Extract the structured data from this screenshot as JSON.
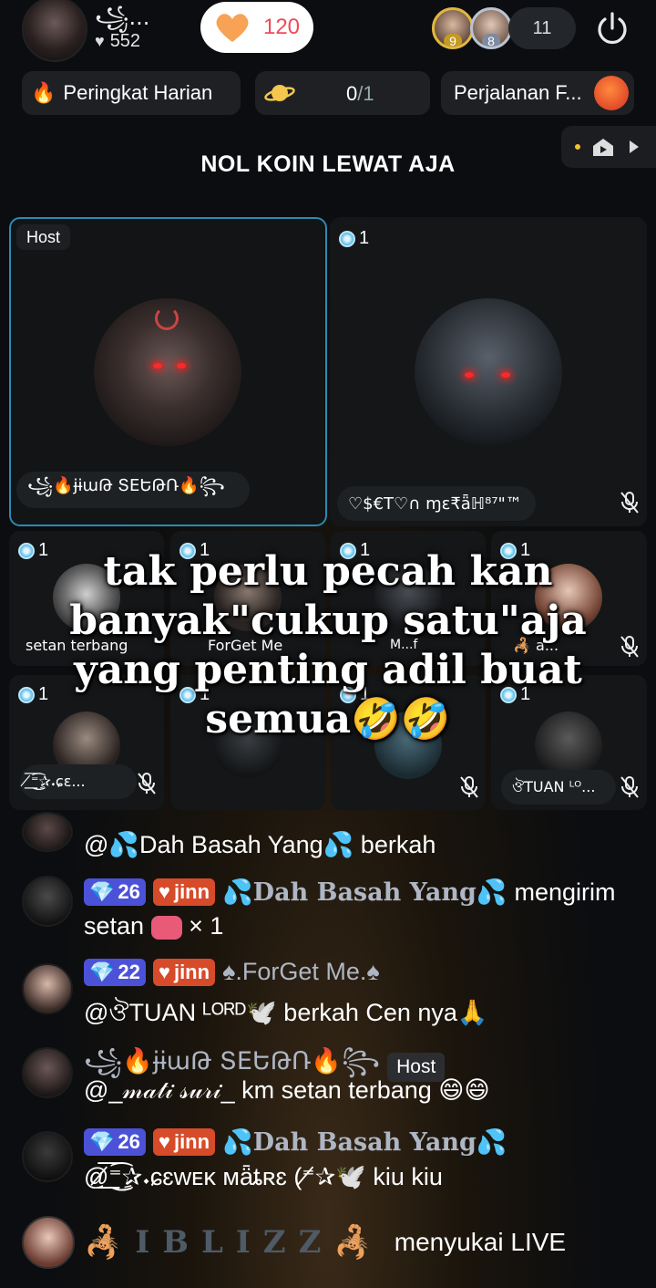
{
  "header": {
    "host_name": "꧁...",
    "host_likes": "552",
    "follow_count": "120",
    "viewers": [
      {
        "rank": "9"
      },
      {
        "rank": "8"
      }
    ],
    "viewer_count": "11"
  },
  "chips": {
    "daily_rank": "Peringkat Harian",
    "progress_value": "0",
    "progress_total": "/1",
    "journey": "Perjalanan F..."
  },
  "room_title": "NOL KOIN LEWAT AJA",
  "seats": {
    "host_tag": "Host",
    "host_name": "꧁🔥ɉɨաԹ ՏEԵԹՌ🔥꧂",
    "seat2_count": "1",
    "seat2_name": "♡$€T♡∩ ɱɛ₹ǟℍ⁸⁷\"™",
    "small": [
      {
        "count": "1",
        "name": "setan terbang"
      },
      {
        "count": "1",
        "name": "ForGet Me"
      },
      {
        "count": "1",
        "name": "M...f"
      },
      {
        "count": "1",
        "name": "🦂 a..."
      },
      {
        "count": "1",
        "name": "⁼̸͟͞✰ٍ͜͡𝆺ɕɛ..."
      },
      {
        "count": "1",
        "name": ""
      },
      {
        "count": "1",
        "name": ""
      },
      {
        "count": "1",
        "name": "ঔTUAN ᴸᴼ..."
      }
    ]
  },
  "overlay_text": "tak perlu pecah kan banyak\"cukup satu\"aja yang penting adil buat semua🤣🤣",
  "chat": [
    {
      "line": "@💦Dah Basah Yang💦 berkah"
    },
    {
      "level": "26",
      "fan": "jinn",
      "sender": "💦Dah Basah Yang💦",
      "text1": "mengirim",
      "text2": "setan",
      "gift": "× 1"
    },
    {
      "level": "22",
      "fan": "jinn",
      "sender": "♠.ForGet Me.♠",
      "text": "@ঔTUAN ᴸᴼᴿᴰ🕊️ berkah Cen nya🙏"
    },
    {
      "sender": "꧁🔥ɉɨաԹ ՏEԵԹՌ🔥꧂",
      "host": "Host",
      "text": "@_𝓂𝒶𝓉𝒾 𝓈𝓊𝓇𝒾_ km setan terbang 😄😄"
    },
    {
      "level": "26",
      "fan": "jinn",
      "sender": "💦Dah Basah Yang💦",
      "text": "@⁼̸͟͞✰ٍ͜͡𝆺ɕɛᴡᴇᴋ ᴍǟȶʀɛ (⁼̸✰🕊️ kiu kiu"
    }
  ],
  "join": {
    "name": "🦂IBLIZZ🦂",
    "text": "menyukai LIVE"
  }
}
